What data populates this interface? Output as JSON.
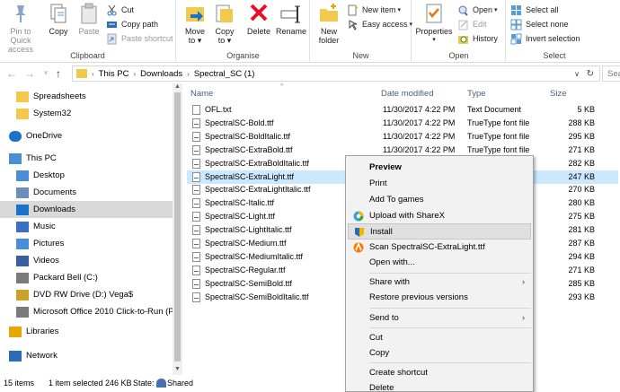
{
  "ribbon": {
    "clipboard": {
      "pin_label": "Pin to Quick access",
      "copy_label": "Copy",
      "paste_label": "Paste",
      "cut_label": "Cut",
      "copy_path_label": "Copy path",
      "paste_shortcut_label": "Paste shortcut",
      "group_label": "Clipboard"
    },
    "organise": {
      "move_to_label": "Move to",
      "copy_to_label": "Copy to",
      "delete_label": "Delete",
      "rename_label": "Rename",
      "group_label": "Organise"
    },
    "new": {
      "new_folder_label": "New folder",
      "new_item_label": "New item",
      "easy_access_label": "Easy access",
      "group_label": "New"
    },
    "open": {
      "properties_label": "Properties",
      "open_label": "Open",
      "edit_label": "Edit",
      "history_label": "History",
      "group_label": "Open"
    },
    "select": {
      "select_all_label": "Select all",
      "select_none_label": "Select none",
      "invert_label": "Invert selection",
      "group_label": "Select"
    }
  },
  "address": {
    "crumbs": [
      "This PC",
      "Downloads",
      "Spectral_SC (1)"
    ],
    "search_placeholder": "Sea"
  },
  "nav": {
    "items": [
      {
        "label": "Spreadsheets",
        "icon": "folder-icon"
      },
      {
        "label": "System32",
        "icon": "folder-icon"
      },
      {
        "label": "OneDrive",
        "icon": "cloud-icon"
      },
      {
        "label": "This PC",
        "icon": "computer-icon"
      },
      {
        "label": "Desktop",
        "icon": "desktop-icon"
      },
      {
        "label": "Documents",
        "icon": "documents-icon"
      },
      {
        "label": "Downloads",
        "icon": "downloads-icon"
      },
      {
        "label": "Music",
        "icon": "music-icon"
      },
      {
        "label": "Pictures",
        "icon": "pictures-icon"
      },
      {
        "label": "Videos",
        "icon": "videos-icon"
      },
      {
        "label": "Packard Bell (C:)",
        "icon": "drive-icon"
      },
      {
        "label": "DVD RW Drive (D:) Vega$",
        "icon": "dvd-icon"
      },
      {
        "label": "Microsoft Office 2010 Click-to-Run (Pr",
        "icon": "drive-icon"
      },
      {
        "label": "Libraries",
        "icon": "libraries-icon"
      },
      {
        "label": "Network",
        "icon": "network-icon"
      }
    ]
  },
  "columns": {
    "name": "Name",
    "date": "Date modified",
    "type": "Type",
    "size": "Size"
  },
  "files": [
    {
      "name": "OFL.txt",
      "date": "11/30/2017 4:22 PM",
      "type": "Text Document",
      "size": "5 KB"
    },
    {
      "name": "SpectralSC-Bold.ttf",
      "date": "11/30/2017 4:22 PM",
      "type": "TrueType font file",
      "size": "288 KB"
    },
    {
      "name": "SpectralSC-BoldItalic.ttf",
      "date": "11/30/2017 4:22 PM",
      "type": "TrueType font file",
      "size": "295 KB"
    },
    {
      "name": "SpectralSC-ExtraBold.ttf",
      "date": "11/30/2017 4:22 PM",
      "type": "TrueType font file",
      "size": "271 KB"
    },
    {
      "name": "SpectralSC-ExtraBoldItalic.ttf",
      "date": "",
      "type": "",
      "size": "282 KB"
    },
    {
      "name": "SpectralSC-ExtraLight.ttf",
      "date": "",
      "type": "",
      "size": "247 KB"
    },
    {
      "name": "SpectralSC-ExtraLightItalic.ttf",
      "date": "",
      "type": "",
      "size": "270 KB"
    },
    {
      "name": "SpectralSC-Italic.ttf",
      "date": "",
      "type": "",
      "size": "280 KB"
    },
    {
      "name": "SpectralSC-Light.ttf",
      "date": "",
      "type": "",
      "size": "275 KB"
    },
    {
      "name": "SpectralSC-LightItalic.ttf",
      "date": "",
      "type": "",
      "size": "281 KB"
    },
    {
      "name": "SpectralSC-Medium.ttf",
      "date": "",
      "type": "",
      "size": "287 KB"
    },
    {
      "name": "SpectralSC-MediumItalic.ttf",
      "date": "",
      "type": "",
      "size": "294 KB"
    },
    {
      "name": "SpectralSC-Regular.ttf",
      "date": "",
      "type": "",
      "size": "271 KB"
    },
    {
      "name": "SpectralSC-SemiBold.ttf",
      "date": "",
      "type": "",
      "size": "285 KB"
    },
    {
      "name": "SpectralSC-SemiBoldItalic.ttf",
      "date": "",
      "type": "",
      "size": "293 KB"
    }
  ],
  "status": {
    "items_count": "15 items",
    "selected": "1 item selected  246 KB",
    "state_label": "State:",
    "state_value": "Shared"
  },
  "context_menu": {
    "items": [
      "Preview",
      "Print",
      "Add To games",
      "Upload with ShareX",
      "Install",
      "Scan SpectralSC-ExtraLight.ttf",
      "Open with...",
      "Share with",
      "Restore previous versions",
      "Send to",
      "Cut",
      "Copy",
      "Create shortcut",
      "Delete"
    ]
  },
  "colors": {
    "selection": "#cce8ff",
    "accent": "#1a73c9",
    "delete_red": "#e81123"
  }
}
